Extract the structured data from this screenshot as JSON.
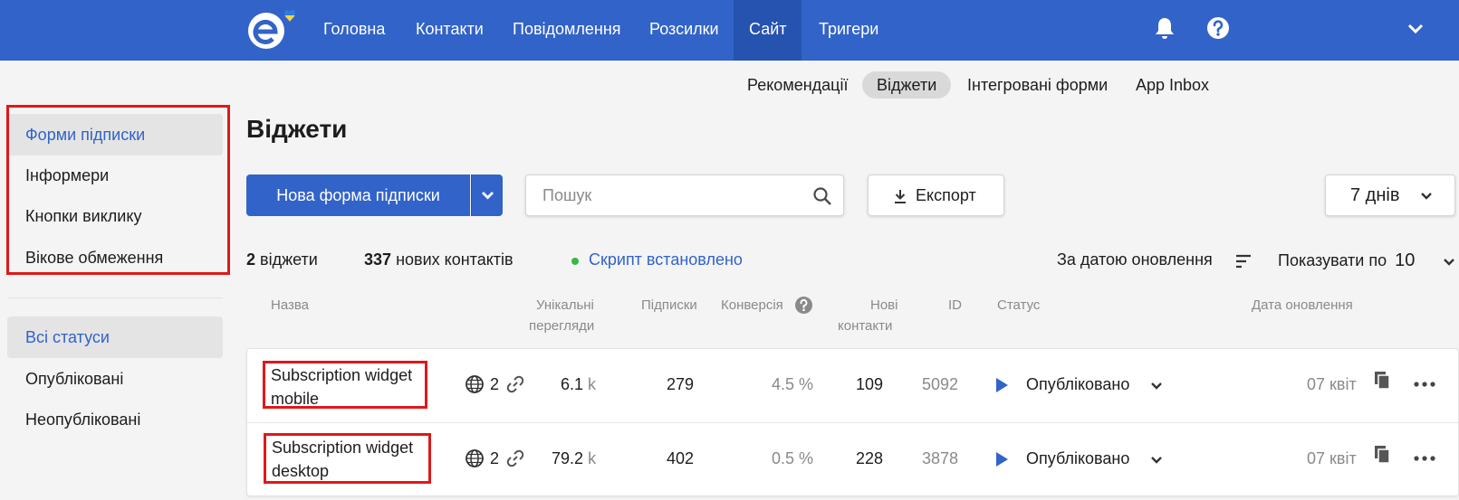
{
  "nav": {
    "items": [
      "Головна",
      "Контакти",
      "Повідомлення",
      "Розсилки",
      "Сайт",
      "Тригери"
    ],
    "active": "Сайт"
  },
  "icons": {
    "logo": "esputnik-logo-icon",
    "notifications": "bell-icon",
    "help": "help-circle-icon",
    "account": "chevron-down-icon",
    "search": "search-icon",
    "export": "download-icon",
    "sort": "sort-lines-icon",
    "globe": "globe-icon",
    "link": "link-icon",
    "play": "play-icon",
    "copy": "copy-icon",
    "more": "more-horizontal-icon"
  },
  "colors": {
    "brand": "#3263c8",
    "highlight": "#e01818",
    "status_dot": "#39b54a"
  },
  "sidebar": {
    "types": [
      "Форми підписки",
      "Інформери",
      "Кнопки виклику",
      "Вікове обмеження"
    ],
    "statuses": [
      "Всі статуси",
      "Опубліковані",
      "Неопубліковані"
    ]
  },
  "subtabs": [
    "Рекомендації",
    "Віджети",
    "Інтегровані форми",
    "App Inbox"
  ],
  "page": {
    "title": "Віджети"
  },
  "toolbar": {
    "new_form": "Нова форма підписки",
    "search_placeholder": "Пошук",
    "export": "Експорт",
    "period": "7 днів"
  },
  "stats": {
    "widgets_count": "2",
    "widgets_label": "віджети",
    "contacts_count": "337",
    "contacts_label": "нових контактів",
    "script_status": "Скрипт встановлено",
    "sort_label": "За датою оновлення",
    "page_size_label": "Показувати по",
    "page_size": "10"
  },
  "table": {
    "headers": {
      "name": "Назва",
      "views_1": "Унікальні",
      "views_2": "перегляди",
      "subscriptions": "Підписки",
      "conversion": "Конверсія",
      "new_contacts_1": "Нові",
      "new_contacts_2": "контакти",
      "id": "ID",
      "status": "Статус",
      "updated": "Дата оновлення"
    },
    "rows": [
      {
        "name_line1": "Subscription widget",
        "name_line2": "mobile",
        "sites": "2",
        "views": "6.1",
        "views_unit": "k",
        "subscriptions": "279",
        "conversion": "4.5",
        "conversion_unit": "%",
        "new_contacts": "109",
        "id": "5092",
        "status": "Опубліковано",
        "updated": "07 квіт"
      },
      {
        "name_line1": "Subscription widget",
        "name_line2": "desktop",
        "sites": "2",
        "views": "79.2",
        "views_unit": "k",
        "subscriptions": "402",
        "conversion": "0.5",
        "conversion_unit": "%",
        "new_contacts": "228",
        "id": "3878",
        "status": "Опубліковано",
        "updated": "07 квіт"
      }
    ]
  }
}
